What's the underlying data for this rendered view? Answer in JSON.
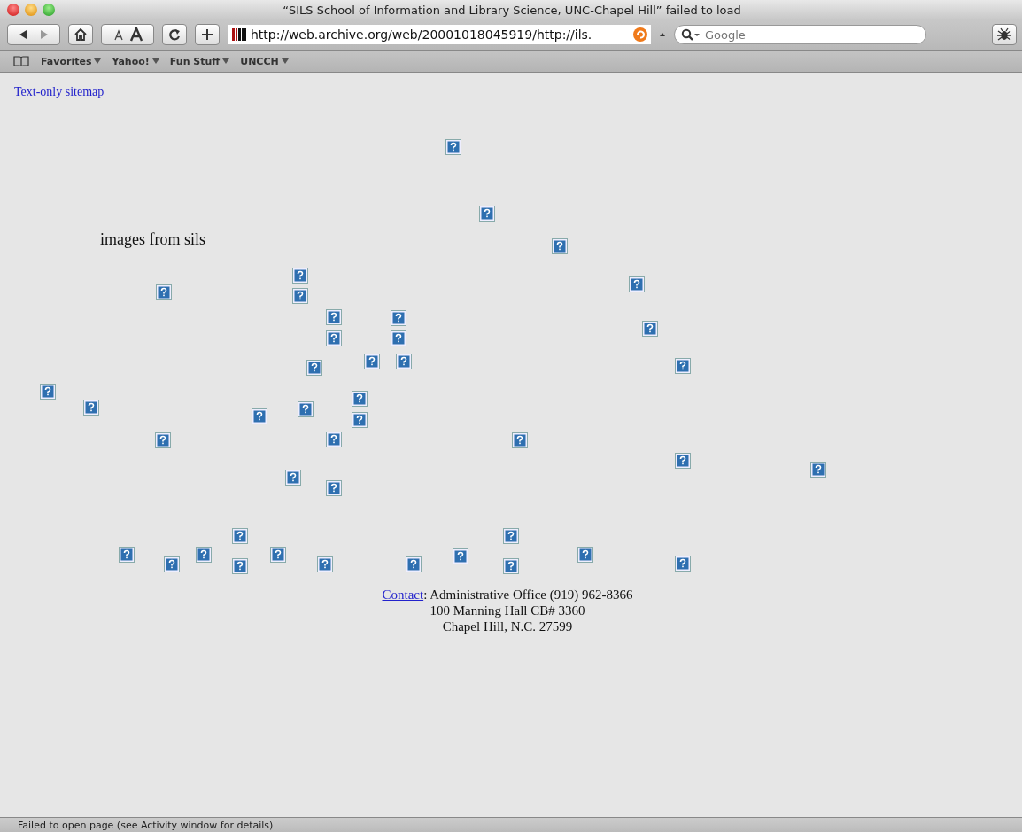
{
  "window": {
    "title": "“SILS School of Information and Library Science, UNC-Chapel Hill” failed to load"
  },
  "toolbar": {
    "address": "http://web.archive.org/web/20001018045919/http://ils.",
    "search": {
      "placeholder": "Google"
    }
  },
  "bookmarks": [
    {
      "label": "Favorites"
    },
    {
      "label": "Yahoo!"
    },
    {
      "label": "Fun Stuff"
    },
    {
      "label": "UNCCH"
    }
  ],
  "page": {
    "sitemap_link": "Text-only sitemap",
    "caption": "images from sils",
    "images": [
      {
        "kind": "broken-image"
      },
      {
        "kind": "broken-image"
      },
      {
        "kind": "broken-image"
      },
      {
        "kind": "broken-image"
      },
      {
        "kind": "broken-image"
      },
      {
        "kind": "broken-image"
      },
      {
        "kind": "broken-image"
      },
      {
        "kind": "broken-image"
      },
      {
        "kind": "broken-image"
      },
      {
        "kind": "broken-image"
      },
      {
        "kind": "broken-image"
      },
      {
        "kind": "broken-image"
      },
      {
        "kind": "broken-image"
      },
      {
        "kind": "broken-image"
      },
      {
        "kind": "broken-image"
      },
      {
        "kind": "broken-image"
      },
      {
        "kind": "broken-image"
      },
      {
        "kind": "broken-image"
      },
      {
        "kind": "broken-image"
      },
      {
        "kind": "broken-image"
      },
      {
        "kind": "broken-image"
      },
      {
        "kind": "broken-image"
      },
      {
        "kind": "broken-image"
      },
      {
        "kind": "broken-image"
      },
      {
        "kind": "broken-image"
      },
      {
        "kind": "broken-image"
      },
      {
        "kind": "broken-image"
      },
      {
        "kind": "broken-image"
      },
      {
        "kind": "broken-image"
      },
      {
        "kind": "broken-image"
      },
      {
        "kind": "broken-image"
      },
      {
        "kind": "broken-image"
      },
      {
        "kind": "broken-image"
      },
      {
        "kind": "broken-image"
      },
      {
        "kind": "broken-image"
      },
      {
        "kind": "broken-image"
      },
      {
        "kind": "broken-image"
      },
      {
        "kind": "broken-image"
      },
      {
        "kind": "broken-image"
      },
      {
        "kind": "broken-image"
      },
      {
        "kind": "broken-image"
      },
      {
        "kind": "broken-image"
      }
    ],
    "contact_link": "Contact",
    "contact_lines": [
      ": Administrative Office (919) 962-8366",
      "100 Manning Hall CB# 3360",
      "Chapel Hill, N.C. 27599"
    ]
  },
  "status_bar": "Failed to open page (see Activity window for details)"
}
